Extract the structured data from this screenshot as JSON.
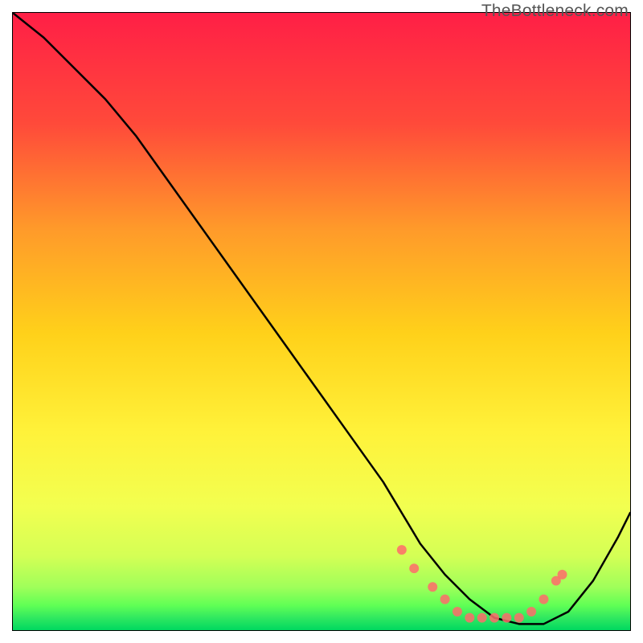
{
  "watermark": "TheBottleneck.com",
  "chart_data": {
    "type": "line",
    "title": "",
    "xlabel": "",
    "ylabel": "",
    "xlim": [
      0,
      100
    ],
    "ylim": [
      0,
      100
    ],
    "gradient_colors": {
      "top": "#ff1f46",
      "upper_mid": "#ff7a2a",
      "mid": "#ffd11a",
      "lower_mid": "#f7ff4a",
      "green_light": "#b6ff5a",
      "green": "#4cff4c",
      "bottom": "#00d860"
    },
    "series": [
      {
        "name": "bottleneck-curve",
        "color": "#000000",
        "x": [
          0,
          5,
          10,
          15,
          20,
          25,
          30,
          35,
          40,
          45,
          50,
          55,
          60,
          63,
          66,
          70,
          74,
          78,
          82,
          86,
          90,
          94,
          98,
          100
        ],
        "y": [
          100,
          96,
          91,
          86,
          80,
          73,
          66,
          59,
          52,
          45,
          38,
          31,
          24,
          19,
          14,
          9,
          5,
          2,
          1,
          1,
          3,
          8,
          15,
          19
        ]
      }
    ],
    "marker_points": {
      "name": "highlight-dots",
      "color": "#ff6b6b",
      "x": [
        63,
        65,
        68,
        70,
        72,
        74,
        76,
        78,
        80,
        82,
        84,
        86,
        88,
        89
      ],
      "y": [
        13,
        10,
        7,
        5,
        3,
        2,
        2,
        2,
        2,
        2,
        3,
        5,
        8,
        9
      ]
    }
  }
}
